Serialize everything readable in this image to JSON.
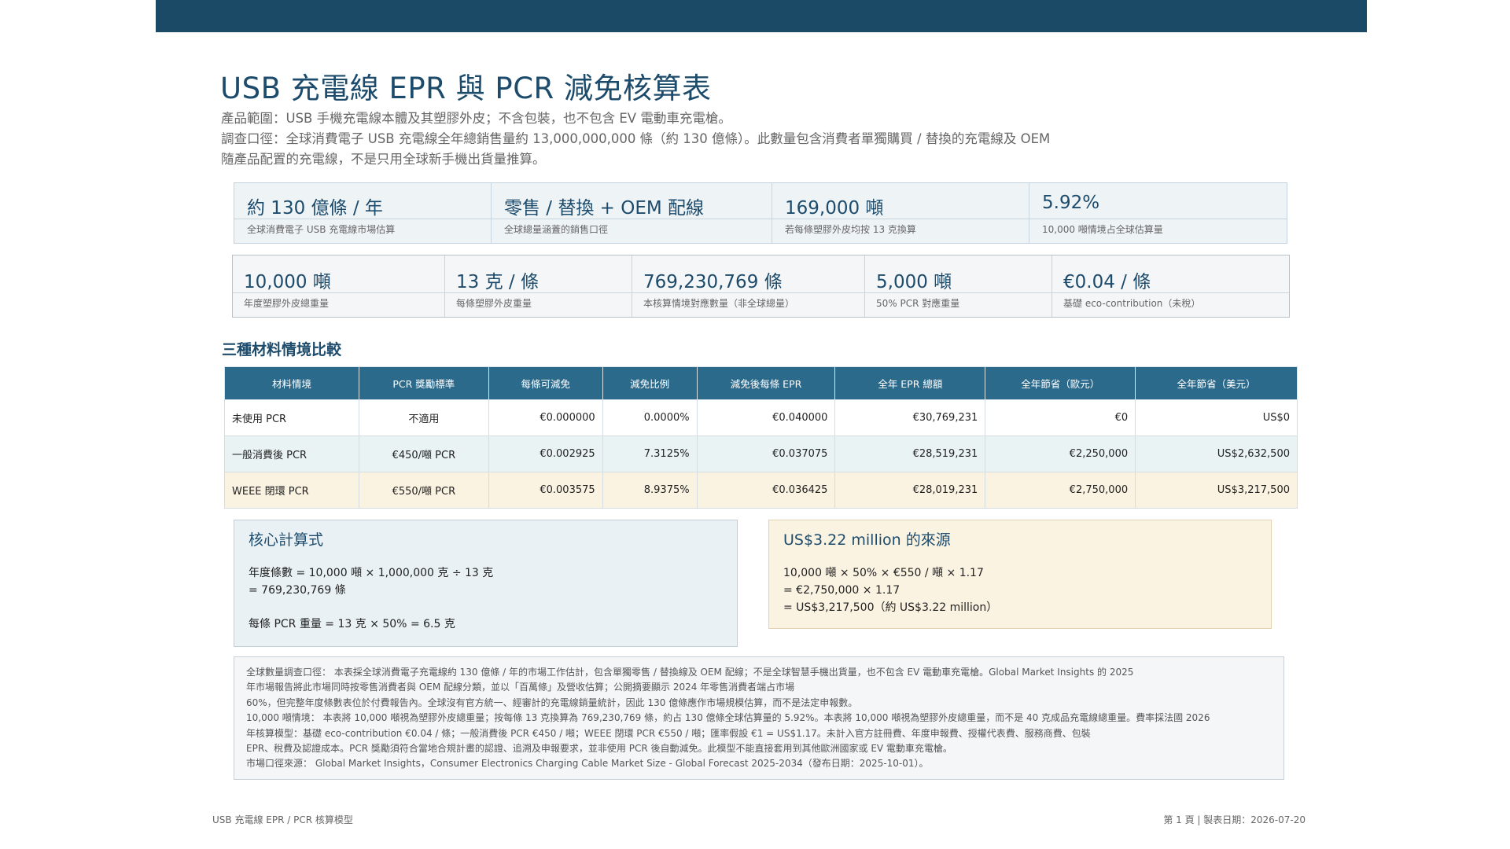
{
  "title": "USB 充電線 EPR 與 PCR 減免核算表",
  "intro": {
    "line1": "產品範圍：USB 手機充電線本體及其塑膠外皮；不含包裝，也不包含 EV 電動車充電槍。",
    "line2": "調查口徑：全球消費電子 USB 充電線全年總銷售量約 13,000,000,000 條（約 130 億條）。此數量包含消費者單獨購買 / 替換的充電線及 OEM",
    "line3": "隨產品配置的充電線，不是只用全球新手機出貨量推算。"
  },
  "cards_row1": [
    {
      "value": "約 130 億條 / 年",
      "label": "全球消費電子 USB 充電線市場估算"
    },
    {
      "value": "零售 / 替換 + OEM 配線",
      "label": "全球總量涵蓋的銷售口徑"
    },
    {
      "value": "169,000 噸",
      "label": "若每條塑膠外皮均按 13 克換算"
    },
    {
      "value": "5.92%",
      "label": "10,000 噸情境占全球估算量"
    }
  ],
  "cards_row2": [
    {
      "value": "10,000 噸",
      "label": "年度塑膠外皮總重量"
    },
    {
      "value": "13 克 / 條",
      "label": "每條塑膠外皮重量"
    },
    {
      "value": "769,230,769 條",
      "label": "本核算情境對應數量（非全球總量）"
    },
    {
      "value": "5,000 噸",
      "label": "50% PCR 對應重量"
    },
    {
      "value": "€0.04 / 條",
      "label": "基礎 eco-contribution（未稅）"
    }
  ],
  "section_title": "三種材料情境比較",
  "table": {
    "headers": [
      "材料情境",
      "PCR 獎勵標準",
      "每條可減免",
      "減免比例",
      "減免後每條 EPR",
      "全年 EPR 總額",
      "全年節省（歐元）",
      "全年節省（美元）"
    ],
    "rows": [
      [
        "未使用 PCR",
        "不適用",
        "€0.000000",
        "0.0000%",
        "€0.040000",
        "€30,769,231",
        "€0",
        "US$0"
      ],
      [
        "一般消費後 PCR",
        "€450/噸 PCR",
        "€0.002925",
        "7.3125%",
        "€0.037075",
        "€28,519,231",
        "€2,250,000",
        "US$2,632,500"
      ],
      [
        "WEEE 閉環 PCR",
        "€550/噸 PCR",
        "€0.003575",
        "8.9375%",
        "€0.036425",
        "€28,019,231",
        "€2,750,000",
        "US$3,217,500"
      ]
    ]
  },
  "formula_box": {
    "title": "核心計算式",
    "line1": "年度條數 = 10,000 噸 × 1,000,000 克 ÷ 13 克",
    "line2": "= 769,230,769 條",
    "line3": "每條 PCR 重量 = 13 克 × 50% = 6.5 克"
  },
  "source_box": {
    "title": "US$3.22 million 的來源",
    "line1": "10,000 噸 × 50% × €550 / 噸 × 1.17",
    "line2": "= €2,750,000 × 1.17",
    "line3": "= US$3,217,500（約 US$3.22 million）"
  },
  "notes": [
    "全球數量調查口徑： 本表採全球消費電子充電線約 130 億條 / 年的市場工作估計，包含單獨零售 / 替換線及 OEM 配線；不是全球智慧手機出貨量，也不包含 EV 電動車充電槍。Global Market Insights 的 2025",
    "年市場報告將此市場同時按零售消費者與 OEM 配線分類，並以「百萬條」及營收估算；公開摘要顯示 2024 年零售消費者端占市場",
    "60%，但完整年度條數表位於付費報告內。全球沒有官方統一、經審計的充電線銷量統計，因此 130 億條應作市場規模估算，而不是法定申報數。",
    "10,000 噸情境： 本表將 10,000 噸視為塑膠外皮總重量；按每條 13 克換算為 769,230,769 條，約占 130 億條全球估算量的 5.92%。本表將 10,000 噸視為塑膠外皮總重量，而不是 40 克成品充電線總重量。費率採法國 2026",
    "年核算模型：基礎 eco-contribution €0.04 / 條；一般消費後 PCR €450 / 噸；WEEE 閉環 PCR €550 / 噸；匯率假設 €1 = US$1.17。未計入官方註冊費、年度申報費、授權代表費、服務商費、包裝",
    "EPR、稅費及認證成本。PCR 獎勵須符合當地合規計畫的認證、追溯及申報要求，並非使用 PCR 後自動減免。此模型不能直接套用到其他歐洲國家或 EV 電動車充電槍。",
    "市場口徑來源： Global Market Insights，Consumer Electronics Charging Cable Market Size - Global Forecast 2025-2034（發布日期：2025-10-01）。"
  ],
  "footer": {
    "left": "USB 充電線 EPR / PCR 核算模型",
    "right": "第 1 頁 | 製表日期：2026-07-20"
  }
}
